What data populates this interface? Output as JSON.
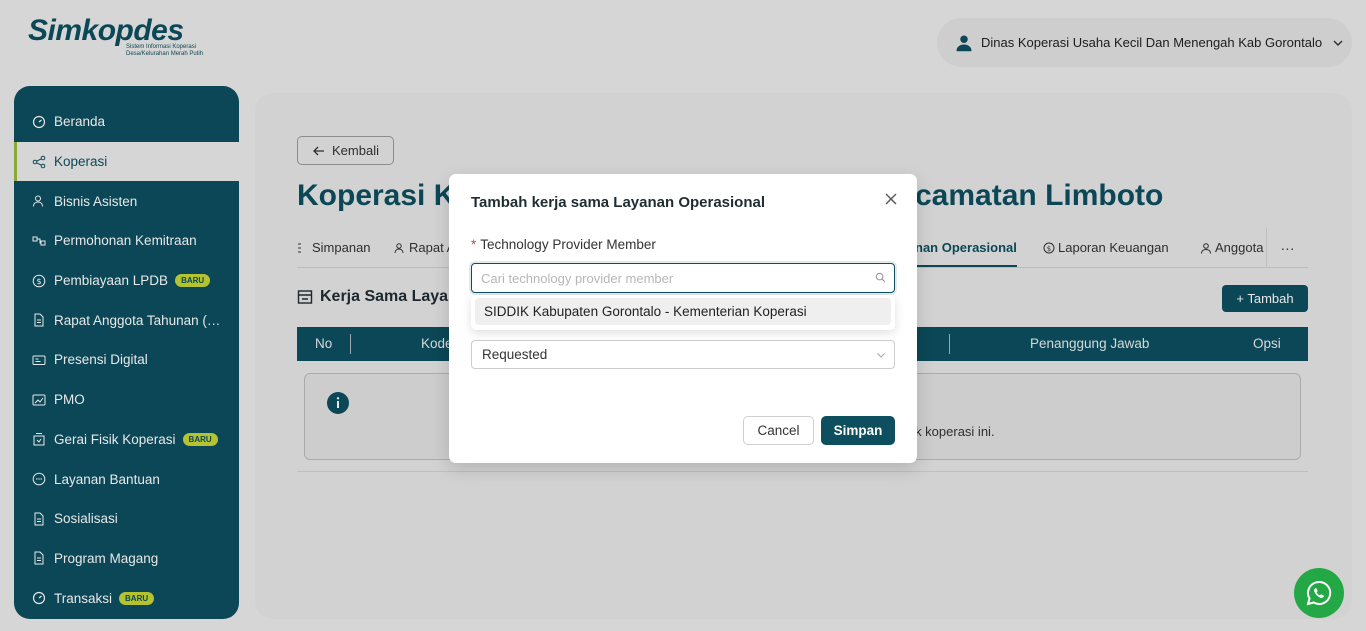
{
  "brand": {
    "logo_text": "Simkopdes",
    "logo_subtitle": "Sistem Informasi Koperasi Desa/Kelurahan Merah Putih",
    "accent": "#0d4f5f",
    "highlight": "#c6d734"
  },
  "header": {
    "user_label": "Dinas Koperasi Usaha Kecil Dan Menengah Kab Gorontalo",
    "user_icon": "user-icon",
    "dropdown_icon": "chevron-down-icon"
  },
  "sidebar": {
    "items": [
      {
        "label": "Beranda",
        "icon": "dashboard-icon",
        "badge": ""
      },
      {
        "label": "Koperasi",
        "icon": "share-icon",
        "badge": ""
      },
      {
        "label": "Bisnis Asisten",
        "icon": "users-icon",
        "badge": ""
      },
      {
        "label": "Permohonan Kemitraan",
        "icon": "partnership-icon",
        "badge": ""
      },
      {
        "label": "Pembiayaan LPDB",
        "icon": "dollar-icon",
        "badge": "BARU"
      },
      {
        "label": "Rapat Anggota Tahunan (RAT)",
        "icon": "document-icon",
        "badge": ""
      },
      {
        "label": "Presensi Digital",
        "icon": "id-card-icon",
        "badge": ""
      },
      {
        "label": "PMO",
        "icon": "chart-icon",
        "badge": ""
      },
      {
        "label": "Gerai Fisik Koperasi",
        "icon": "store-icon",
        "badge": "BARU"
      },
      {
        "label": "Layanan Bantuan",
        "icon": "chat-icon",
        "badge": ""
      },
      {
        "label": "Sosialisasi",
        "icon": "document-icon",
        "badge": ""
      },
      {
        "label": "Program Magang",
        "icon": "document-icon",
        "badge": ""
      },
      {
        "label": "Transaksi",
        "icon": "dashboard-icon",
        "badge": "BARU"
      }
    ],
    "active_index": 1
  },
  "main": {
    "back_label": "Kembali",
    "title_left": "Koperasi Ke",
    "title_right": "camatan Limboto",
    "tabs": [
      "Simpanan",
      "Rapat A",
      "nan Operasional",
      "Laporan Keuangan",
      "Anggota"
    ],
    "more": "···",
    "section_title": "Kerja Sama Layan",
    "add_label": "+ Tambah",
    "table_headers": [
      "No",
      "Kode",
      "Penanggung Jawab",
      "Opsi"
    ],
    "empty_text": "ntuk koperasi ini."
  },
  "modal": {
    "title": "Tambah kerja sama Layanan Operasional",
    "field_label": "Technology Provider Member",
    "search_placeholder": "Cari technology provider member",
    "dropdown_option": "SIDDIK Kabupaten Gorontalo - Kementerian Koperasi",
    "status_value": "Requested",
    "cancel_label": "Cancel",
    "save_label": "Simpan"
  }
}
